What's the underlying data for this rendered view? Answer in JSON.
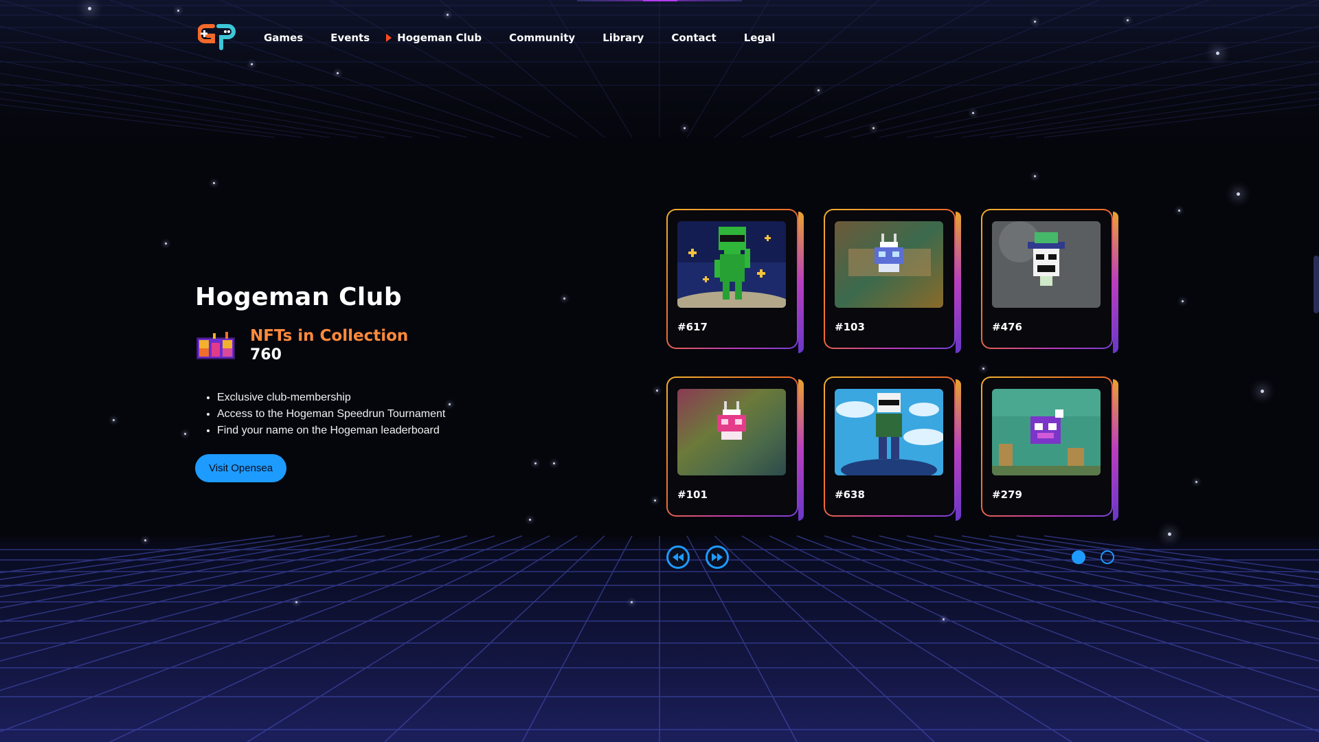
{
  "nav": {
    "items": [
      {
        "label": "Games",
        "active": false
      },
      {
        "label": "Events",
        "active": false
      },
      {
        "label": "Hogeman Club",
        "active": true
      },
      {
        "label": "Community",
        "active": false
      },
      {
        "label": "Library",
        "active": false
      },
      {
        "label": "Contact",
        "active": false
      },
      {
        "label": "Legal",
        "active": false
      }
    ]
  },
  "hero": {
    "title": "Hogeman Club",
    "stat_label": "NFTs in Collection",
    "stat_value": "760",
    "features": [
      "Exclusive club-membership",
      "Access to the Hogeman Speedrun Tournament",
      "Find your name on the Hogeman leaderboard"
    ],
    "cta_label": "Visit Opensea"
  },
  "cards": [
    {
      "label": "#617",
      "art": "green-alien-icon"
    },
    {
      "label": "#103",
      "art": "blue-robot-icon"
    },
    {
      "label": "#476",
      "art": "green-hat-skull-icon"
    },
    {
      "label": "#101",
      "art": "pink-robot-icon"
    },
    {
      "label": "#638",
      "art": "skull-man-sky-icon"
    },
    {
      "label": "#279",
      "art": "purple-creature-icon"
    }
  ],
  "carousel": {
    "pages": 2,
    "current_page": 1
  },
  "colors": {
    "accent": "#1e9bff",
    "stat_label": "#ff8a3c",
    "active_marker": "#ff4a1f",
    "background": "#05060c"
  }
}
